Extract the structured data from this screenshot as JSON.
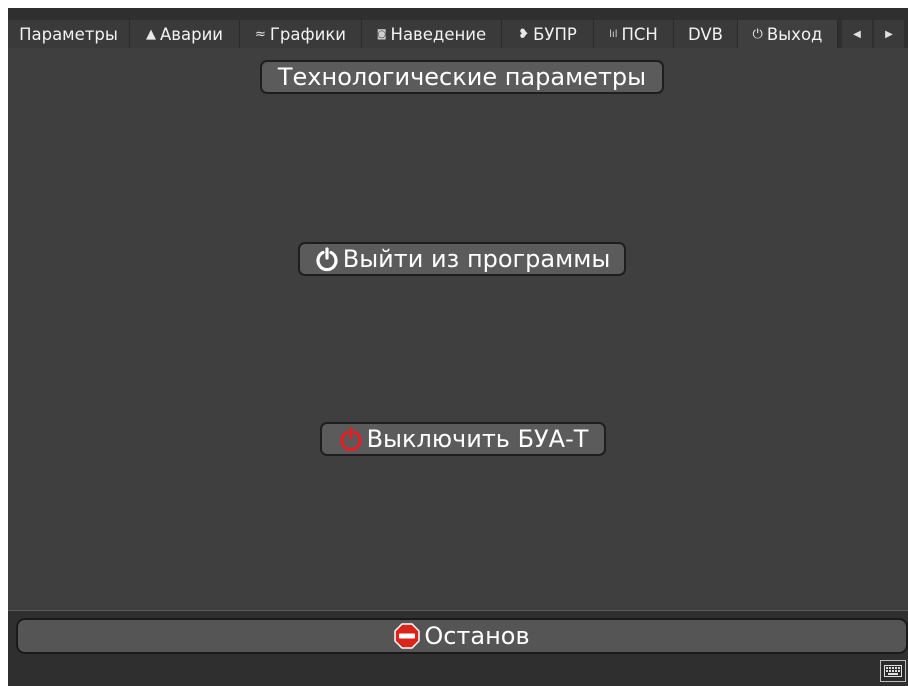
{
  "tabs": [
    {
      "label": "Параметры",
      "icon": ""
    },
    {
      "label": "Аварии",
      "icon": "warning-icon"
    },
    {
      "label": "Графики",
      "icon": "chart-wave-icon"
    },
    {
      "label": "Наведение",
      "icon": "target-icon"
    },
    {
      "label": "БУПР",
      "icon": "satellite-dish-icon"
    },
    {
      "label": "ПСН",
      "icon": "signal-bars-icon"
    },
    {
      "label": "DVB",
      "icon": ""
    },
    {
      "label": "Выход",
      "icon": "power-icon",
      "active": true
    }
  ],
  "buttons": {
    "tech_params": "Технологические параметры",
    "exit_program": "Выйти из программы",
    "shutdown": "Выключить БУА-Т",
    "stop": "Останов"
  },
  "glyphs": {
    "warning": "▲",
    "chart": "≈",
    "target": "◙",
    "dish": "❥",
    "bars": "lıl",
    "power": "⏻",
    "left": "◀",
    "right": "▶"
  },
  "colors": {
    "shutdown_icon": "#e31e24",
    "stop_icon": "#d9251c"
  }
}
